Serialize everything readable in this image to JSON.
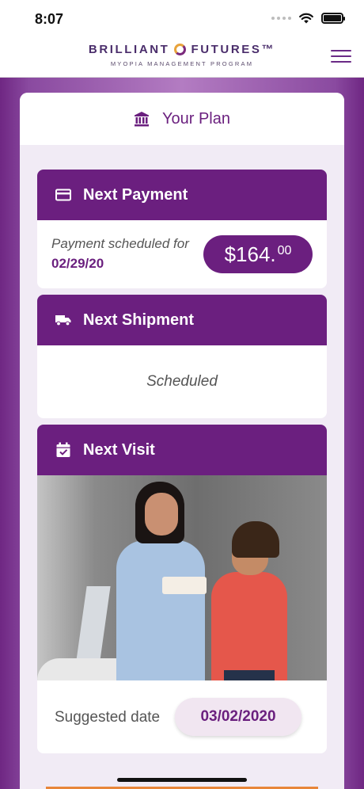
{
  "status_bar": {
    "time": "8:07"
  },
  "header": {
    "brand_name_left": "BRILLIANT",
    "brand_name_right": "FUTURES™",
    "brand_subtitle": "MYOPIA MANAGEMENT PROGRAM",
    "menu_icon": "hamburger-menu-icon"
  },
  "plan": {
    "title": "Your Plan",
    "icon": "bank-icon"
  },
  "next_payment": {
    "title": "Next Payment",
    "icon": "credit-card-icon",
    "scheduled_label": "Payment scheduled for",
    "date": "02/29/20",
    "amount_whole": "$164.",
    "amount_cents": "00"
  },
  "next_shipment": {
    "title": "Next Shipment",
    "icon": "truck-icon",
    "status": "Scheduled"
  },
  "next_visit": {
    "title": "Next Visit",
    "icon": "calendar-check-icon",
    "suggested_label": "Suggested date",
    "suggested_date": "03/02/2020"
  },
  "colors": {
    "brand_purple": "#6b1f7f",
    "accent_orange": "#e8863a"
  }
}
